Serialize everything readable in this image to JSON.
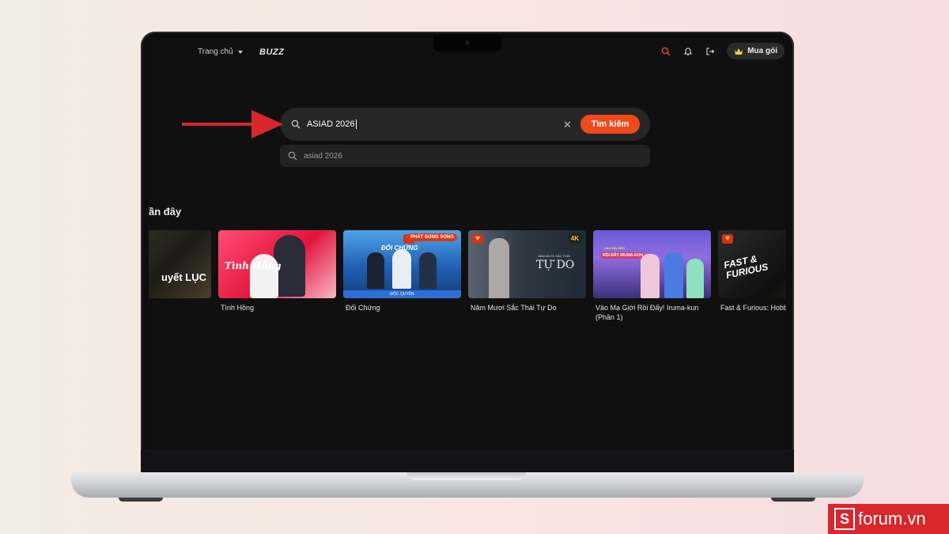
{
  "nav": {
    "home_label": "Trang chủ",
    "brand_label": "BUZZ",
    "buy_label": "Mua gói",
    "icons": [
      "search-icon",
      "bell-icon",
      "logout-icon",
      "crown-icon"
    ]
  },
  "search": {
    "query": "ASIAD 2026",
    "button_label": "Tìm kiếm",
    "suggestion": "asiad 2026",
    "clear_icon": "close-icon"
  },
  "recent": {
    "section_title": "ần đây",
    "items": [
      {
        "title": "",
        "thumb_text": "uyết LỤC"
      },
      {
        "title": "Tình Hồng",
        "thumb_text": "Tình Hồng"
      },
      {
        "title": "Đối Chứng",
        "thumb_text": "ĐỐI CHỨNG",
        "badge": "PHÁT SONG SONG",
        "footer": "ĐỘC QUYỀN"
      },
      {
        "title": "Năm Mươi Sắc Thái Tự Do",
        "thumb_text": "TỰ DO",
        "thumb_subtext": "NĂM MƯƠI SẮC THÁI",
        "badge": "4K"
      },
      {
        "title": "Vào Ma Giới Rồi Đấy! Iruma-kun (Phần 1)",
        "thumb_text": "RỒI ĐẤY IRUMA-KUN",
        "thumb_subtext": "VÀO MA GIỚI"
      },
      {
        "title": "Fast & Furious: Hobb",
        "thumb_text": "FAST & FURIOUS"
      }
    ]
  },
  "watermark": {
    "letter": "S",
    "text": "forum.vn"
  },
  "colors": {
    "accent": "#ee4a1c",
    "screen_bg": "#101010",
    "search_bg": "#262626",
    "annotation_arrow": "#d8262a"
  }
}
